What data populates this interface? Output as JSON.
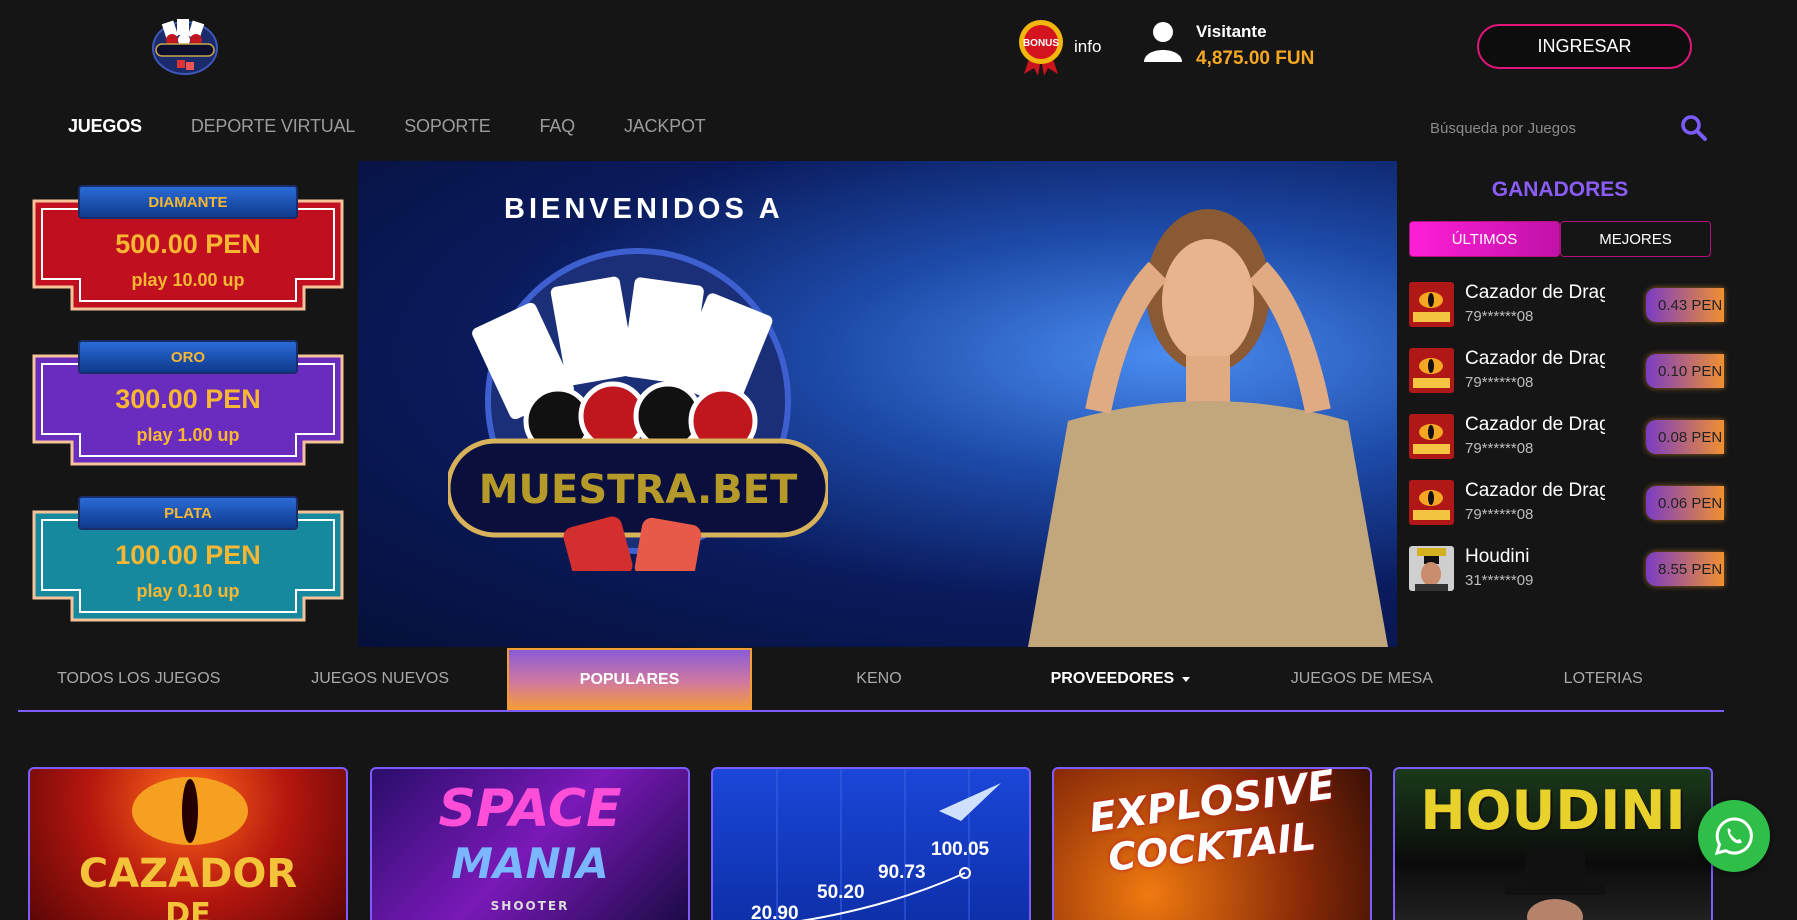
{
  "header": {
    "bonus_badge_text": "BONUS",
    "info_label": "info",
    "user_name": "Visitante",
    "user_balance": "4,875.00 FUN",
    "login_label": "INGRESAR"
  },
  "nav": {
    "items": [
      "JUEGOS",
      "DEPORTE VIRTUAL",
      "SOPORTE",
      "FAQ",
      "JACKPOT"
    ]
  },
  "search": {
    "placeholder": "Búsqueda por Juegos"
  },
  "jackpots": [
    {
      "title": "DIAMANTE",
      "amount": "500.00 PEN",
      "play": "play 10.00 up",
      "color": "#c01020"
    },
    {
      "title": "ORO",
      "amount": "300.00 PEN",
      "play": "play 1.00 up",
      "color": "#6a2bbf"
    },
    {
      "title": "PLATA",
      "amount": "100.00 PEN",
      "play": "play 0.10 up",
      "color": "#17899e"
    }
  ],
  "banner": {
    "welcome": "BIENVENIDOS A",
    "logo_text": "MUESTRA.BET"
  },
  "winners": {
    "title": "GANADORES",
    "tabs": [
      "ÚLTIMOS",
      "MEJORES"
    ],
    "rows": [
      {
        "game": "Cazador de Dragones",
        "user": "79******08",
        "amount": "0.43 PEN"
      },
      {
        "game": "Cazador de Dragones",
        "user": "79******08",
        "amount": "0.10 PEN"
      },
      {
        "game": "Cazador de Dragones",
        "user": "79******08",
        "amount": "0.08 PEN"
      },
      {
        "game": "Cazador de Dragones",
        "user": "79******08",
        "amount": "0.06 PEN"
      },
      {
        "game": "Houdini",
        "user": "31******09",
        "amount": "8.55 PEN"
      }
    ]
  },
  "categories": [
    "TODOS LOS JUEGOS",
    "JUEGOS NUEVOS",
    "POPULARES",
    "KENO",
    "PROVEEDORES",
    "JUEGOS DE MESA",
    "LOTERIAS"
  ],
  "games": [
    {
      "title": "CAZADOR",
      "subtitle": "DE"
    },
    {
      "title": "SPACE",
      "subtitle": "MANIA",
      "tag": "SHOOTER"
    },
    {
      "values": [
        "100.05",
        "90.73",
        "50.20",
        "20.90"
      ]
    },
    {
      "title": "EXPLOSIVE",
      "subtitle": "COCKTAIL"
    },
    {
      "title": "HOUDINI"
    }
  ],
  "colors": {
    "accent": "#7c5cff",
    "gold": "#f5a623",
    "magenta": "#e0157a",
    "whatsapp": "#2fbf48"
  }
}
